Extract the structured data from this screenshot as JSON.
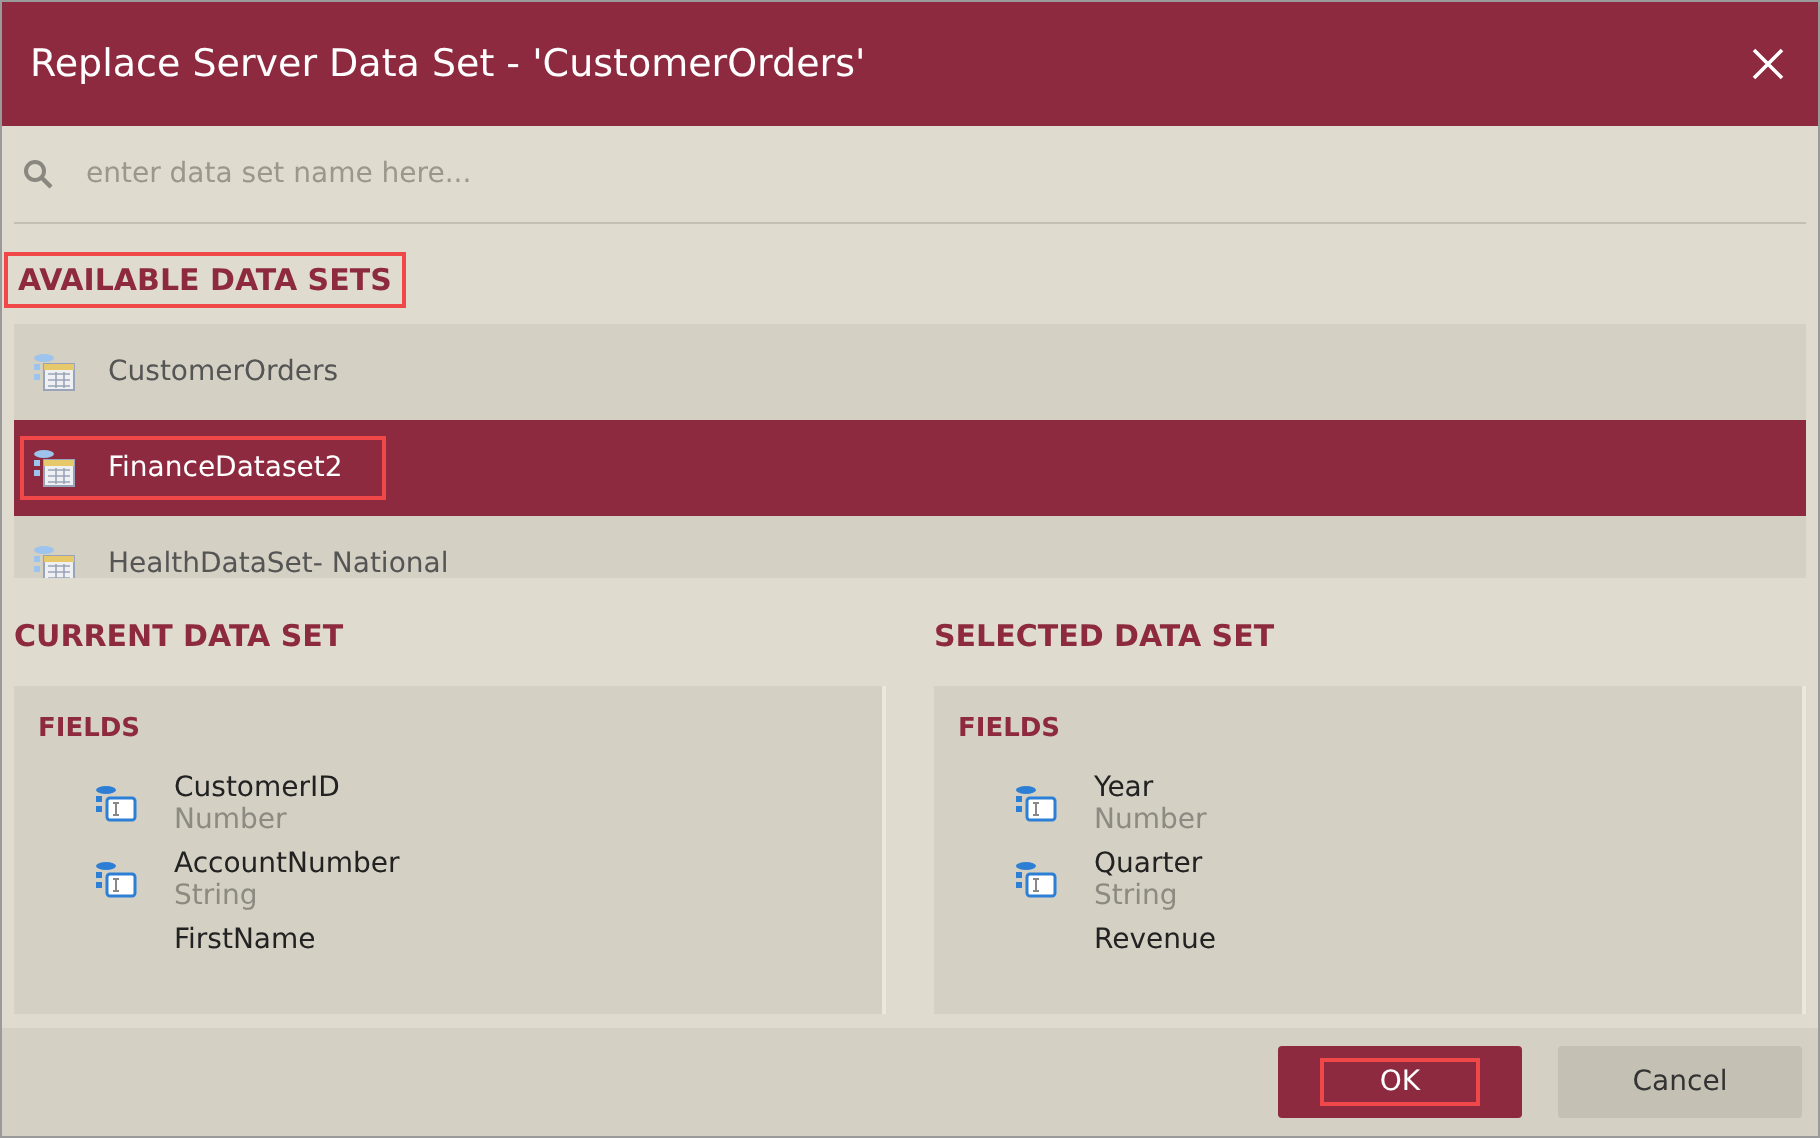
{
  "window": {
    "title": "Replace Server Data Set - 'CustomerOrders'"
  },
  "search": {
    "placeholder": "enter data set name here..."
  },
  "available": {
    "heading": "AVAILABLE DATA SETS",
    "highlighted": true,
    "items": [
      {
        "label": "CustomerOrders",
        "selected": false,
        "highlighted": false
      },
      {
        "label": "FinanceDataset2",
        "selected": true,
        "highlighted": true
      },
      {
        "label": "HealthDataSet- National",
        "selected": false,
        "highlighted": false
      }
    ]
  },
  "panels": [
    {
      "heading": "CURRENT DATA SET",
      "fields_heading": "FIELDS",
      "fields": [
        {
          "name": "CustomerID",
          "type": "Number"
        },
        {
          "name": "AccountNumber",
          "type": "String"
        },
        {
          "name": "FirstName"
        }
      ]
    },
    {
      "heading": "SELECTED DATA SET",
      "fields_heading": "FIELDS",
      "fields": [
        {
          "name": "Year",
          "type": "Number"
        },
        {
          "name": "Quarter",
          "type": "String"
        },
        {
          "name": "Revenue"
        }
      ]
    }
  ],
  "buttons": [
    {
      "label": "OK",
      "kind": "primary",
      "highlighted": true
    },
    {
      "label": "Cancel",
      "kind": "secondary",
      "highlighted": false
    }
  ]
}
